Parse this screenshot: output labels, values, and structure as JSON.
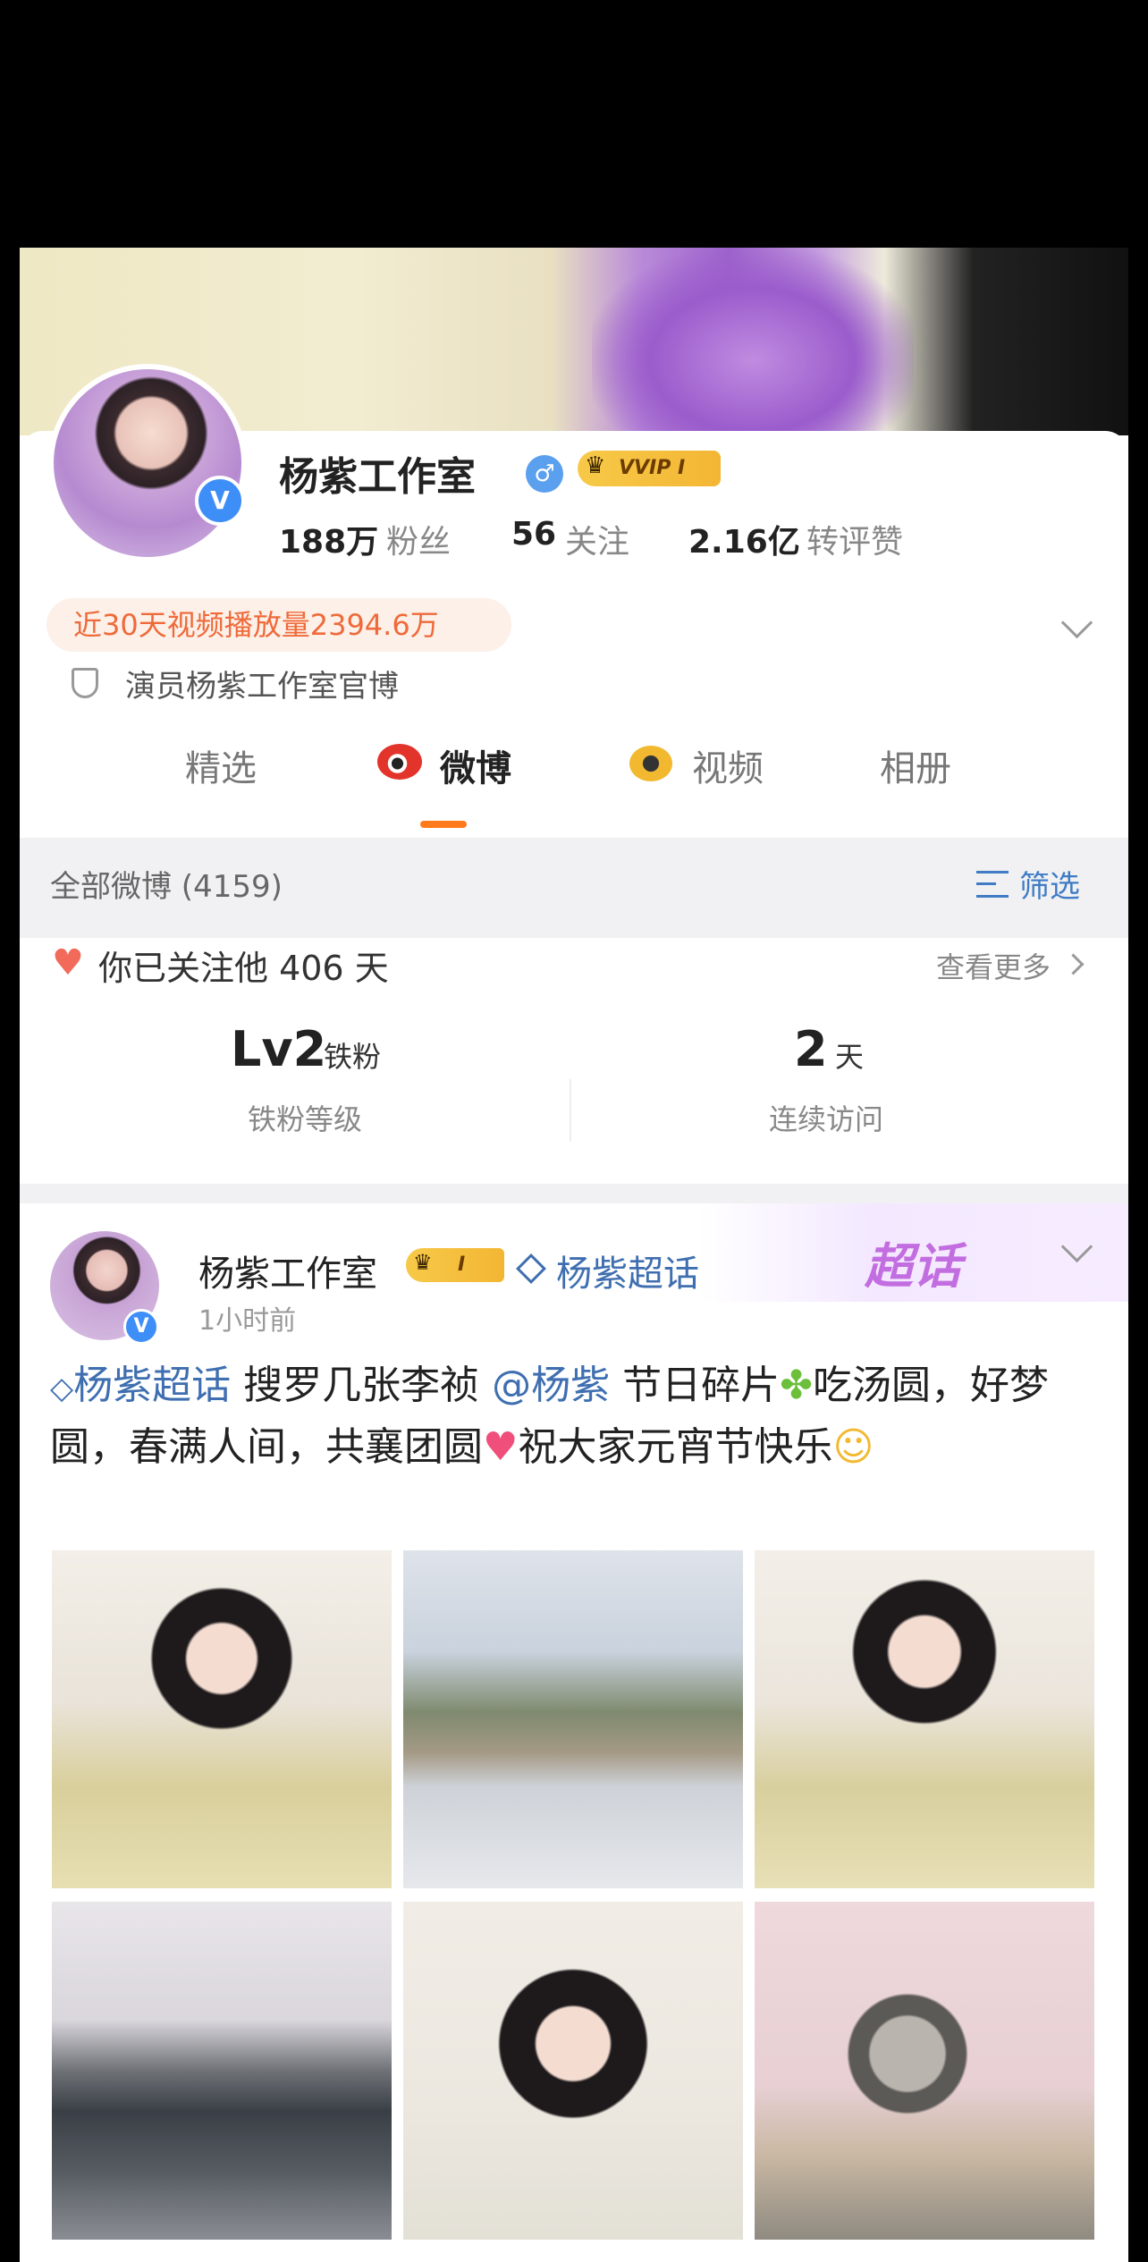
{
  "profile": {
    "name": "杨紫工作室",
    "vip_badge": "VVIP I",
    "stats": {
      "fans_value": "188万",
      "fans_label": "粉丝",
      "following_value": "56",
      "following_label": "关注",
      "likes_value": "2.16亿",
      "likes_label": "转评赞"
    },
    "video_plays": "近30天视频播放量2394.6万",
    "verification": "演员杨紫工作室官博"
  },
  "tabs": [
    {
      "label": "精选",
      "active": false
    },
    {
      "label": "微博",
      "active": true
    },
    {
      "label": "视频",
      "active": false
    },
    {
      "label": "相册",
      "active": false
    }
  ],
  "section": {
    "title": "全部微博 (4159)",
    "filter_label": "筛选"
  },
  "fan_info": {
    "followed_text": "你已关注他 406 天",
    "more_label": "查看更多",
    "level_value": "Lv2",
    "level_unit": "铁粉",
    "level_label": "铁粉等级",
    "visit_value": "2",
    "visit_unit": "天",
    "visit_label": "连续访问"
  },
  "post": {
    "author": "杨紫工作室",
    "author_badge": "I",
    "topic_tag": "杨紫超话",
    "topic_banner": "超话",
    "time": "1小时前",
    "text_topic": "杨紫超话",
    "text_1": " 搜罗几张李祯 ",
    "text_mention": "@杨紫",
    "text_2": " 节日碎片",
    "text_3": "吃汤圆，好梦圆，春满人间，共襄团圆",
    "text_4": "祝大家元宵节快乐"
  },
  "colors": {
    "accent_orange": "#ff7a1a",
    "link_blue": "#3f6fb0",
    "verified_blue": "#3e8ef7",
    "vip_gold": "#f3b634"
  }
}
